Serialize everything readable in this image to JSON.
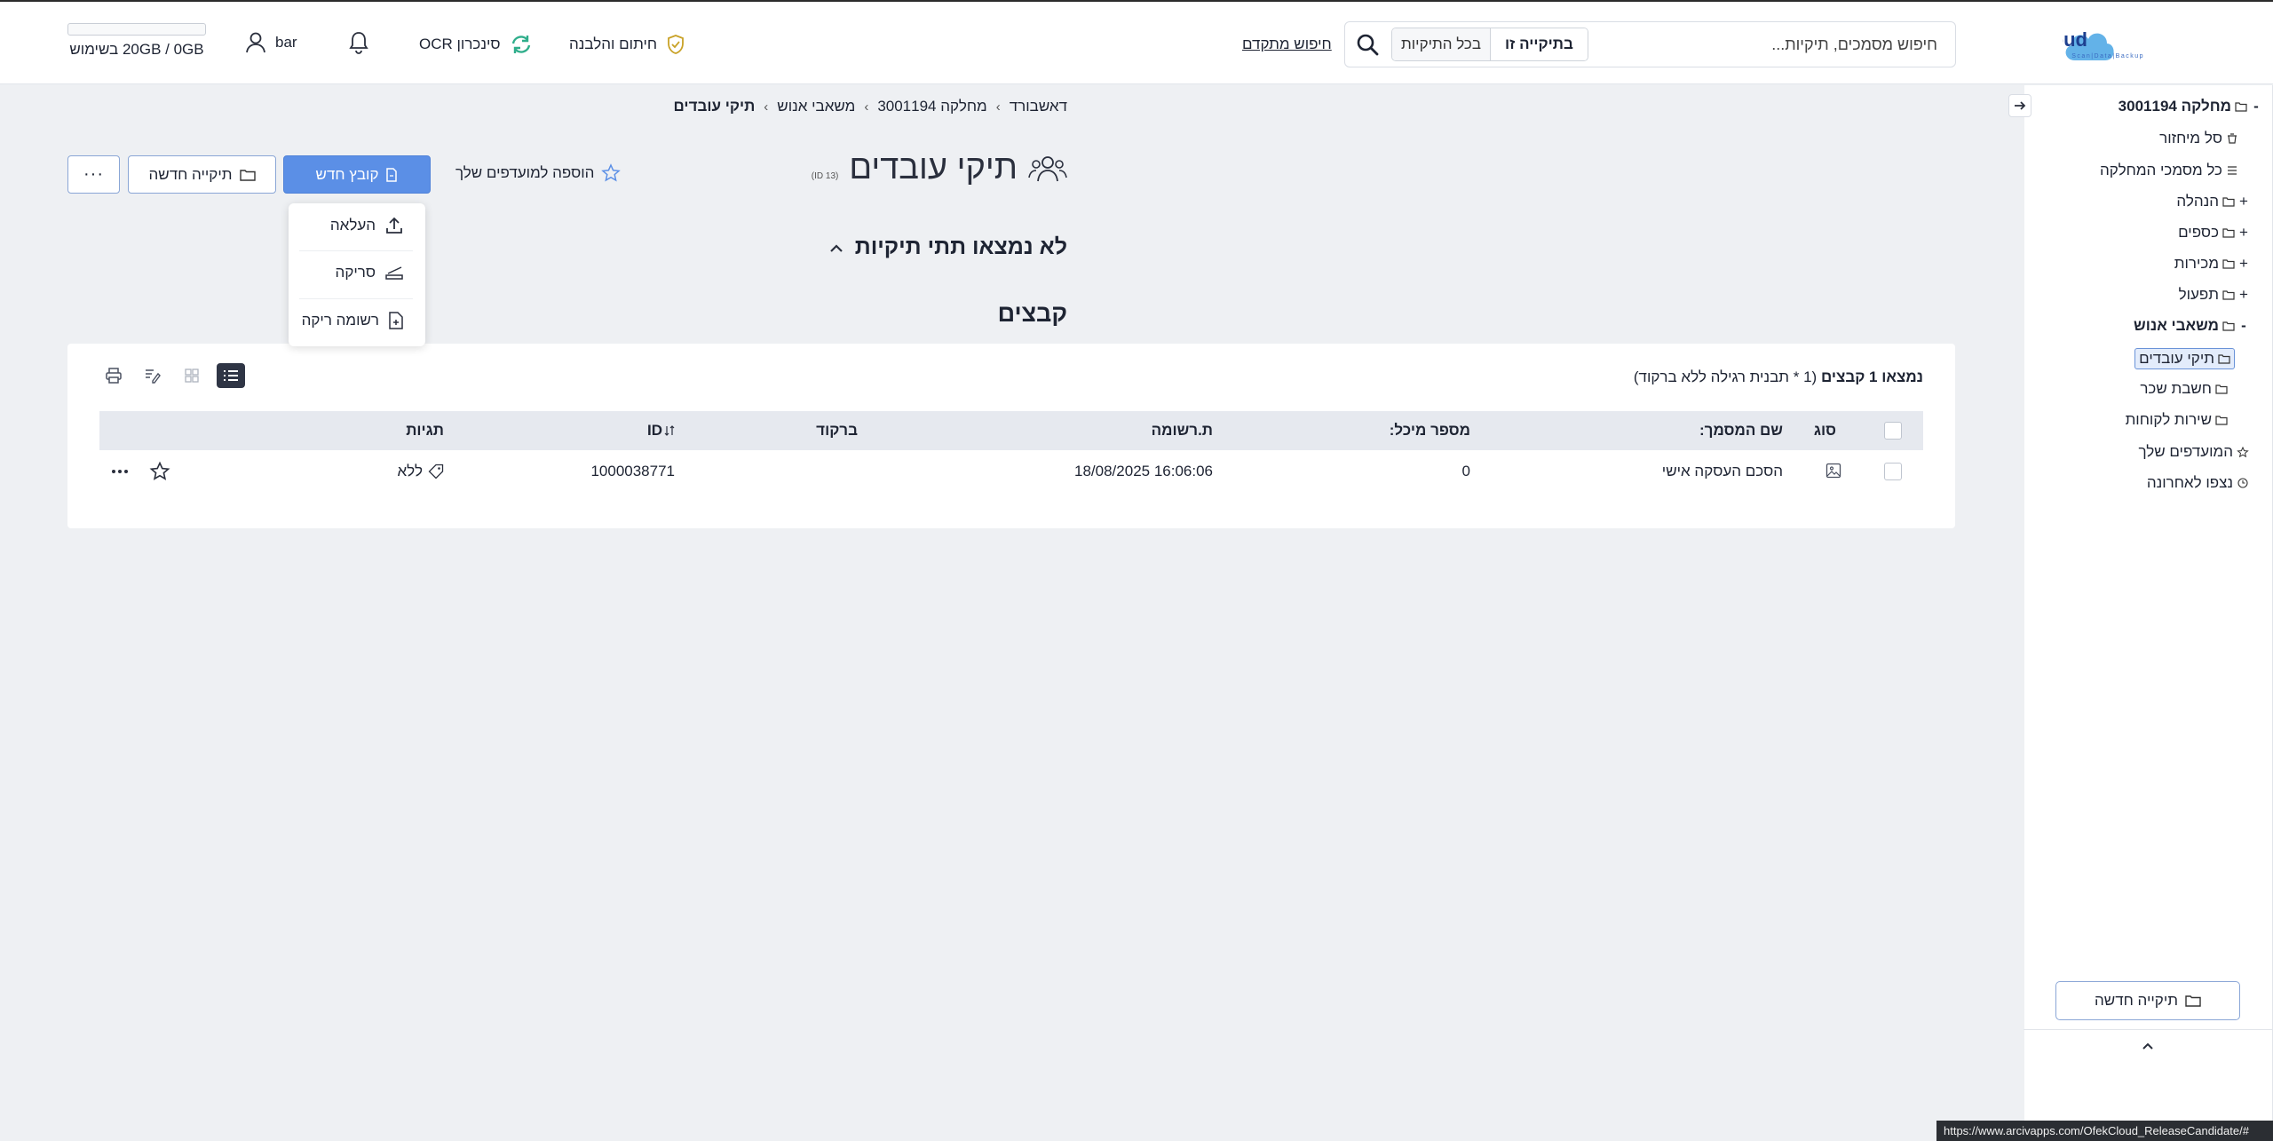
{
  "header": {
    "logo_text": "Archive1Cloud",
    "logo_tagline": "Scan|Data|Backup",
    "search": {
      "placeholder": "חיפוש מסמכים, תיקיות...",
      "scope_active": "בתיקייה זו",
      "scope_other": "בכל התיקיות"
    },
    "advanced_search": "חיפוש מתקדם",
    "signing": "חיתום והלבנה",
    "ocr_sync": "סינכרון OCR",
    "user": "bar",
    "storage": "20GB / 0GB בשימוש"
  },
  "sidebar": {
    "root": {
      "label": "מחלקה 3001194",
      "toggle": "-"
    },
    "items": [
      {
        "label": "סל מיחזור",
        "toggle": ""
      },
      {
        "label": "כל מסמכי המחלקה",
        "toggle": ""
      },
      {
        "label": "הנהלה",
        "toggle": "+"
      },
      {
        "label": "כספים",
        "toggle": "+"
      },
      {
        "label": "מכירות",
        "toggle": "+"
      },
      {
        "label": "תפעול",
        "toggle": "+"
      },
      {
        "label": "משאבי אנוש",
        "toggle": "-"
      }
    ],
    "children": [
      {
        "label": "תיקי עובדים"
      },
      {
        "label": "חשבת שכר"
      },
      {
        "label": "שירות לקוחות"
      }
    ],
    "favorites": "המועדפים שלך",
    "recent": "נצפו לאחרונה",
    "new_folder": "תיקייה חדשה"
  },
  "breadcrumb": [
    "דאשבורד",
    "מחלקה 3001194",
    "משאבי אנוש",
    "תיקי עובדים"
  ],
  "page": {
    "title": "תיקי עובדים",
    "id_tag": "(ID 13)",
    "subfolders_label": "לא נמצאו תתי תיקיות",
    "files_heading": "קבצים"
  },
  "actions": {
    "add_favorite": "הוספה למועדפים שלך",
    "new_file": "קובץ חדש",
    "new_folder": "תיקייה חדשה",
    "more": "···"
  },
  "new_file_menu": [
    "העלאה",
    "סריקה",
    "רשומה ריקה"
  ],
  "files": {
    "found_bold": "נמצאו 1 קבצים",
    "found_note": "(1 * תבנית רגילה ללא ברקוד)",
    "columns": [
      "סוג",
      "שם המסמך:",
      "מספר מיכל:",
      "ת.רשומה",
      "ברקוד",
      "ID",
      "תגיות"
    ],
    "rows": [
      {
        "name": "הסכם העסקה אישי",
        "container": "0",
        "record_date": "18/08/2025 16:06:06",
        "barcode": "",
        "id": "1000038771",
        "tags": "ללא"
      }
    ]
  },
  "status_url": "https://www.arcivapps.com/OfekCloud_ReleaseCandidate/#"
}
